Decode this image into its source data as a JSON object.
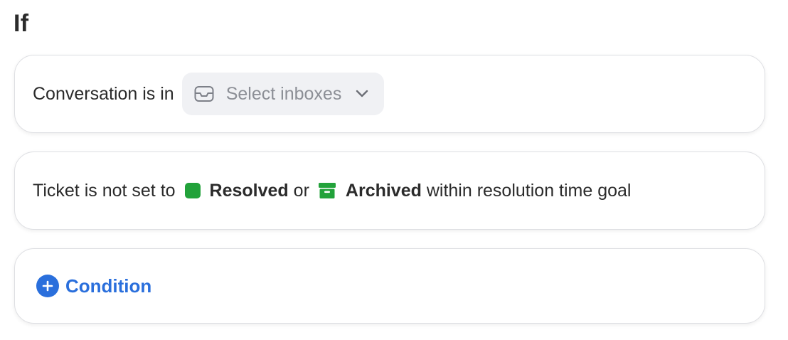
{
  "section": {
    "heading": "If"
  },
  "condition_inbox": {
    "label": "Conversation is in",
    "select": {
      "icon": "inbox-icon",
      "placeholder": "Select inboxes",
      "chevron": "chevron-down-icon"
    }
  },
  "condition_ticket": {
    "prefix": "Ticket is not set to",
    "status_resolved": {
      "label": "Resolved",
      "icon": "resolved-square-icon",
      "color": "#22a23a"
    },
    "connector": "or",
    "status_archived": {
      "label": "Archived",
      "icon": "archive-box-icon",
      "color": "#22a23a"
    },
    "suffix": "within resolution time goal"
  },
  "add_condition": {
    "icon": "plus-circle-icon",
    "label": "Condition",
    "color": "#2a6fdc"
  }
}
